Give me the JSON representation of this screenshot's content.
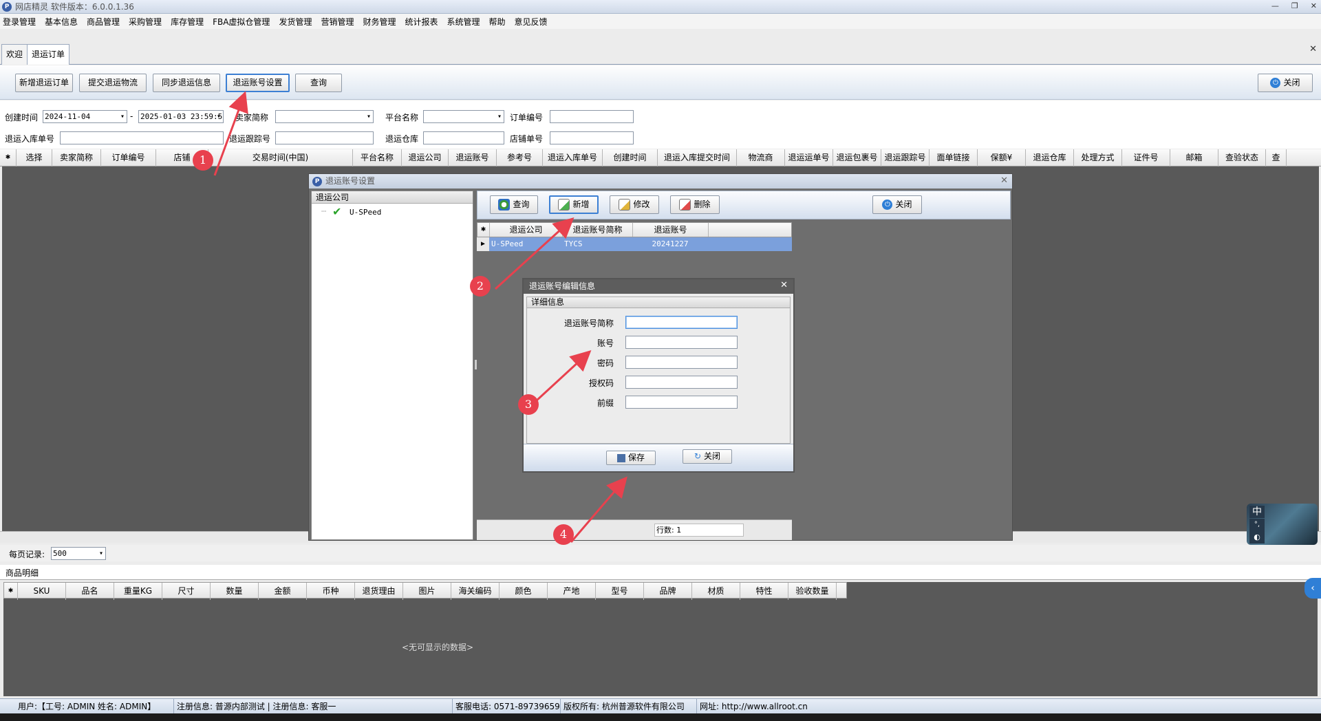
{
  "window": {
    "title": "网店精灵  软件版本：6.0.0.1.36",
    "controls": [
      "—",
      "❐",
      "✕"
    ]
  },
  "menu": [
    "登录管理",
    "基本信息",
    "商品管理",
    "采购管理",
    "库存管理",
    "FBA虚拟仓管理",
    "发货管理",
    "营销管理",
    "财务管理",
    "统计报表",
    "系统管理",
    "帮助",
    "意见反馈"
  ],
  "tabs": [
    "欢迎",
    "退运订单"
  ],
  "toolbar": {
    "buttons": [
      "新增退运订单",
      "提交退运物流",
      "同步退运信息",
      "退运账号设置",
      "查询"
    ],
    "close": "关闭"
  },
  "filters": {
    "created_label": "创建时间",
    "date_from": "2024-11-04",
    "date_sep": "-",
    "date_to": "2025-01-03 23:59:5",
    "seller_label": "卖家简称",
    "platform_label": "平台名称",
    "order_label": "订单编号",
    "inbound_label": "退运入库单号",
    "tracking_label": "退运跟踪号",
    "warehouse_label": "退运仓库",
    "store_order_label": "店铺单号"
  },
  "main_columns": [
    "选择",
    "卖家简称",
    "订单编号",
    "店铺",
    "交易时间(中国)",
    "平台名称",
    "退运公司",
    "退运账号",
    "参考号",
    "退运入库单号",
    "创建时间",
    "退运入库提交时间",
    "物流商",
    "退运运单号",
    "退运包裹号",
    "退运跟踪号",
    "面单链接",
    "保额¥",
    "退运仓库",
    "处理方式",
    "证件号",
    "邮箱",
    "查验状态",
    "查"
  ],
  "pager": {
    "label": "每页记录:",
    "value": "500"
  },
  "detail": {
    "section": "商品明细",
    "columns": [
      "SKU",
      "品名",
      "重量KG",
      "尺寸",
      "数量",
      "金额",
      "币种",
      "退货理由",
      "图片",
      "海关编码",
      "颜色",
      "产地",
      "型号",
      "品牌",
      "材质",
      "特性",
      "验收数量"
    ],
    "empty": "<无可显示的数据>"
  },
  "status": {
    "user": "用户:【工号: ADMIN  姓名: ADMIN】",
    "reg": "注册信息: 普源内部测试 | 注册信息: 客服一",
    "phone": "客服电话: 0571-89739659",
    "copyright": "版权所有: 杭州普源软件有限公司",
    "site": "网址: http://www.allroot.cn"
  },
  "dialog": {
    "title": "退运账号设置",
    "tree_header": "退运公司",
    "tree_item": "U-SPeed",
    "buttons": [
      "查询",
      "新增",
      "修改",
      "删除"
    ],
    "close": "关闭",
    "columns": [
      "退运公司",
      "退运账号简称",
      "退运账号"
    ],
    "rows": [
      [
        "U-SPeed",
        "TYCS",
        "20241227"
      ]
    ],
    "rowcount": "行数: 1"
  },
  "subdialog": {
    "title": "退运账号编辑信息",
    "section": "详细信息",
    "fields": [
      "退运账号简称",
      "账号",
      "密码",
      "授权码",
      "前缀"
    ],
    "save": "保存",
    "close": "关闭"
  },
  "markers": [
    "1",
    "2",
    "3",
    "4"
  ],
  "ime": {
    "lang": "中",
    "mode1": "°,",
    "mode2": "◐"
  },
  "colors": {
    "accent": "#3c7fd3",
    "marker": "#e8414e",
    "selected_row": "#7ba0dc",
    "dark_area": "#595959"
  }
}
